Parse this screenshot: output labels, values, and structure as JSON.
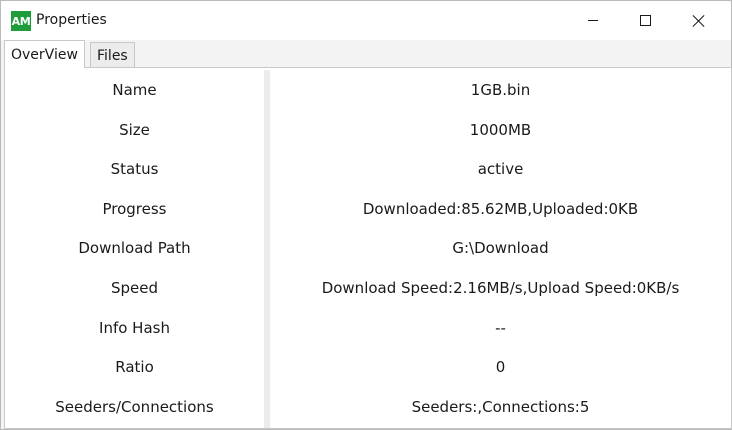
{
  "window": {
    "app_icon_text": "AM",
    "title": "Properties",
    "controls": [
      "minimize",
      "maximize",
      "close"
    ]
  },
  "tabs": [
    {
      "label": "OverView",
      "selected": true
    },
    {
      "label": "Files",
      "selected": false
    }
  ],
  "overview": {
    "rows": [
      {
        "label": "Name",
        "value": "1GB.bin"
      },
      {
        "label": "Size",
        "value": "1000MB"
      },
      {
        "label": "Status",
        "value": "active"
      },
      {
        "label": "Progress",
        "value": "Downloaded:85.62MB,Uploaded:0KB"
      },
      {
        "label": "Download Path",
        "value": "G:\\Download"
      },
      {
        "label": "Speed",
        "value": "Download Speed:2.16MB/s,Upload Speed:0KB/s"
      },
      {
        "label": "Info Hash",
        "value": "--"
      },
      {
        "label": "Ratio",
        "value": "0"
      },
      {
        "label": "Seeders/Connections",
        "value": "Seeders:,Connections:5"
      }
    ]
  },
  "colors": {
    "app_icon": "#1f9d3a",
    "window_background": "#f3f3f3",
    "content_background": "#ffffff"
  }
}
